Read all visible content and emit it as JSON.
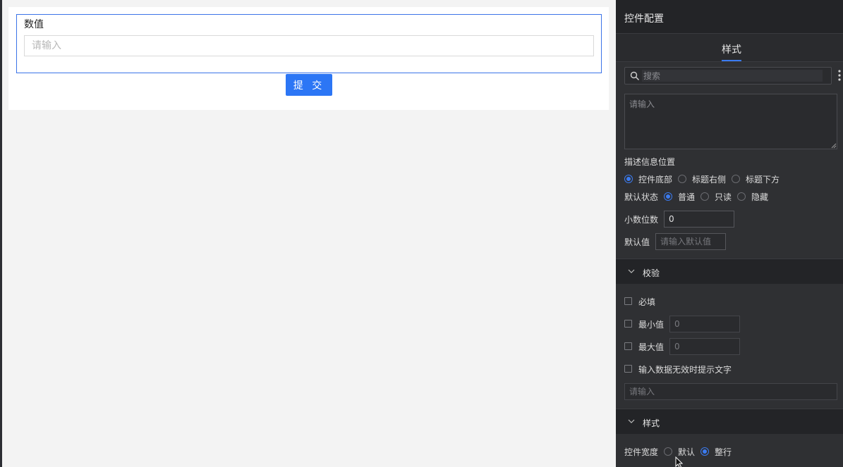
{
  "form": {
    "field_label": "数值",
    "field_placeholder": "请输入",
    "submit_label": "提 交"
  },
  "panel": {
    "title": "控件配置",
    "tab": "样式",
    "search_placeholder": "搜索",
    "desc_placeholder": "请输入",
    "desc_position": {
      "label": "描述信息位置",
      "options": [
        "控件底部",
        "标题右侧",
        "标题下方"
      ],
      "selected": "控件底部"
    },
    "default_state": {
      "label": "默认状态",
      "options": [
        "普通",
        "只读",
        "隐藏"
      ],
      "selected": "普通"
    },
    "decimal": {
      "label": "小数位数",
      "value": "0"
    },
    "default_value": {
      "label": "默认值",
      "placeholder": "请输入默认值"
    },
    "validation": {
      "title": "校验",
      "required_label": "必填",
      "min_label": "最小值",
      "min_placeholder": "0",
      "max_label": "最大值",
      "max_placeholder": "0",
      "invalid_tip_label": "输入数据无效时提示文字",
      "invalid_tip_placeholder": "请输入"
    },
    "style": {
      "title": "样式",
      "width_label": "控件宽度",
      "options": [
        "默认",
        "整行"
      ],
      "selected": "整行"
    }
  },
  "colors": {
    "accent": "#3b7bf0",
    "panel_bg": "#2f3033",
    "header_bg": "#232427",
    "submit_bg": "#2c76f5",
    "canvas_bg": "#f3f3f3"
  }
}
